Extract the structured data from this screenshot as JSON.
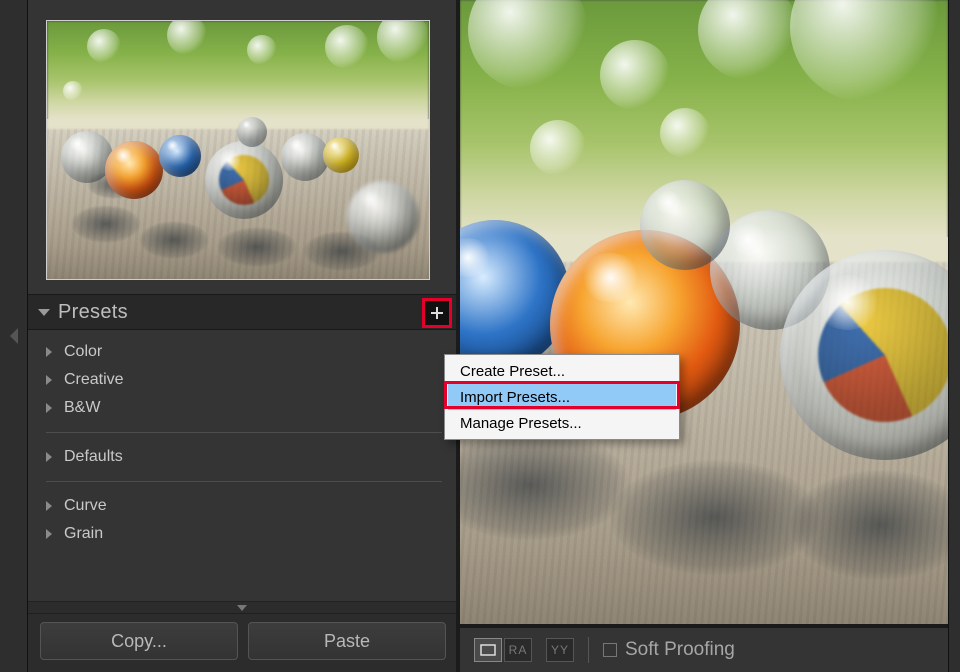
{
  "panel": {
    "title": "Presets",
    "groups_a": [
      "Color",
      "Creative",
      "B&W"
    ],
    "groups_b": [
      "Defaults"
    ],
    "groups_c": [
      "Curve",
      "Grain"
    ]
  },
  "buttons": {
    "copy": "Copy...",
    "paste": "Paste"
  },
  "context_menu": {
    "items": [
      {
        "label": "Create Preset...",
        "highlight": false
      },
      {
        "label": "Import Presets...",
        "highlight": true
      },
      {
        "label": "Manage Presets...",
        "highlight": false
      }
    ]
  },
  "toolbar": {
    "mode_ra": "RA",
    "mode_yy": "YY",
    "soft_proofing": "Soft Proofing"
  }
}
